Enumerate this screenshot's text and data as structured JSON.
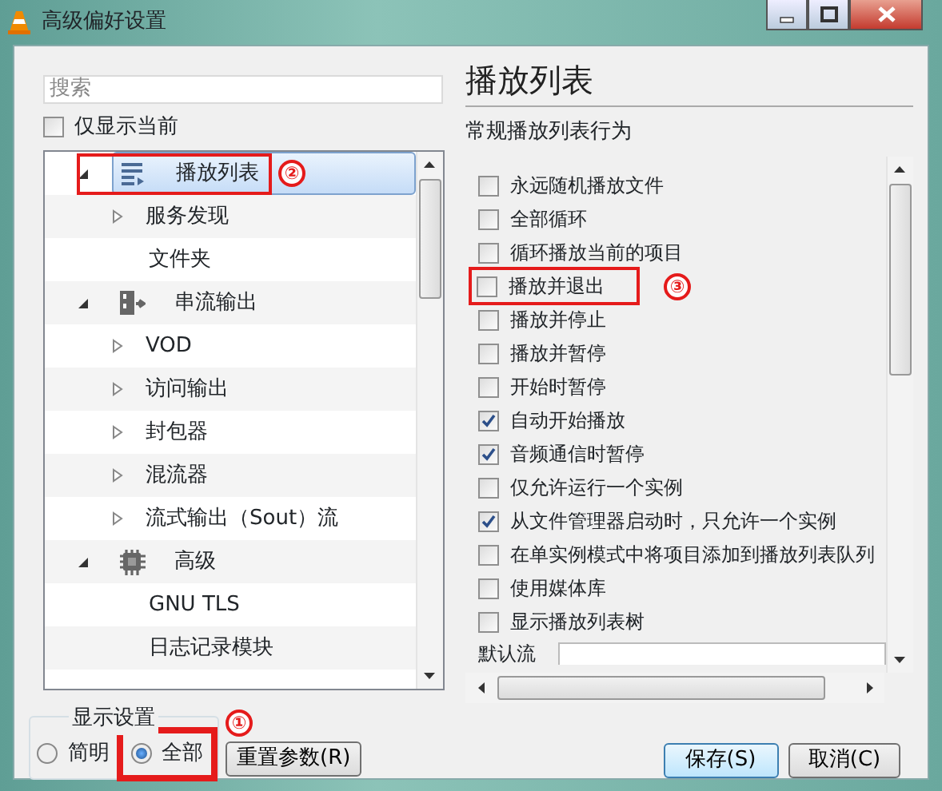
{
  "window": {
    "title": "高级偏好设置"
  },
  "search": {
    "placeholder": "搜索"
  },
  "show_current_only": {
    "label": "仅显示当前",
    "checked": false
  },
  "tree": [
    {
      "label": "播放列表",
      "kind": "playlist",
      "expanded": true,
      "selected": true,
      "annotation": "②",
      "children": [
        {
          "label": "服务发现",
          "expanded": false
        },
        {
          "label": "文件夹"
        }
      ]
    },
    {
      "label": "串流输出",
      "kind": "stream",
      "expanded": true,
      "selected": false,
      "children": [
        {
          "label": "VOD",
          "expanded": false
        },
        {
          "label": "访问输出",
          "expanded": false
        },
        {
          "label": "封包器",
          "expanded": false
        },
        {
          "label": "混流器",
          "expanded": false
        },
        {
          "label": "流式输出（Sout）流",
          "expanded": false
        }
      ]
    },
    {
      "label": "高级",
      "kind": "gear",
      "expanded": true,
      "selected": false,
      "children": [
        {
          "label": "GNU TLS"
        },
        {
          "label": "日志记录模块"
        }
      ]
    }
  ],
  "panel": {
    "title": "播放列表",
    "section": "常规播放列表行为",
    "options": [
      {
        "label": "永远随机播放文件",
        "checked": false
      },
      {
        "label": "全部循环",
        "checked": false
      },
      {
        "label": "循环播放当前的项目",
        "checked": false
      },
      {
        "label": "播放并退出",
        "checked": false,
        "annotation": "③"
      },
      {
        "label": "播放并停止",
        "checked": false
      },
      {
        "label": "播放并暂停",
        "checked": false
      },
      {
        "label": "开始时暂停",
        "checked": false
      },
      {
        "label": "自动开始播放",
        "checked": true
      },
      {
        "label": "音频通信时暂停",
        "checked": true
      },
      {
        "label": "仅允许运行一个实例",
        "checked": false
      },
      {
        "label": "从文件管理器启动时，只允许一个实例",
        "checked": true
      },
      {
        "label": "在单实例模式中将项目添加到播放列表队列",
        "checked": false
      },
      {
        "label": "使用媒体库",
        "checked": false
      },
      {
        "label": "显示播放列表树",
        "checked": false
      }
    ],
    "default_stream": {
      "label": "默认流"
    }
  },
  "display_settings": {
    "title": "显示设置",
    "options": [
      {
        "label": "简明",
        "selected": false
      },
      {
        "label": "全部",
        "selected": true,
        "annotation": "①"
      }
    ]
  },
  "reset_button": "重置参数(R)",
  "buttons": [
    "保存(S)",
    "取消(C)"
  ]
}
